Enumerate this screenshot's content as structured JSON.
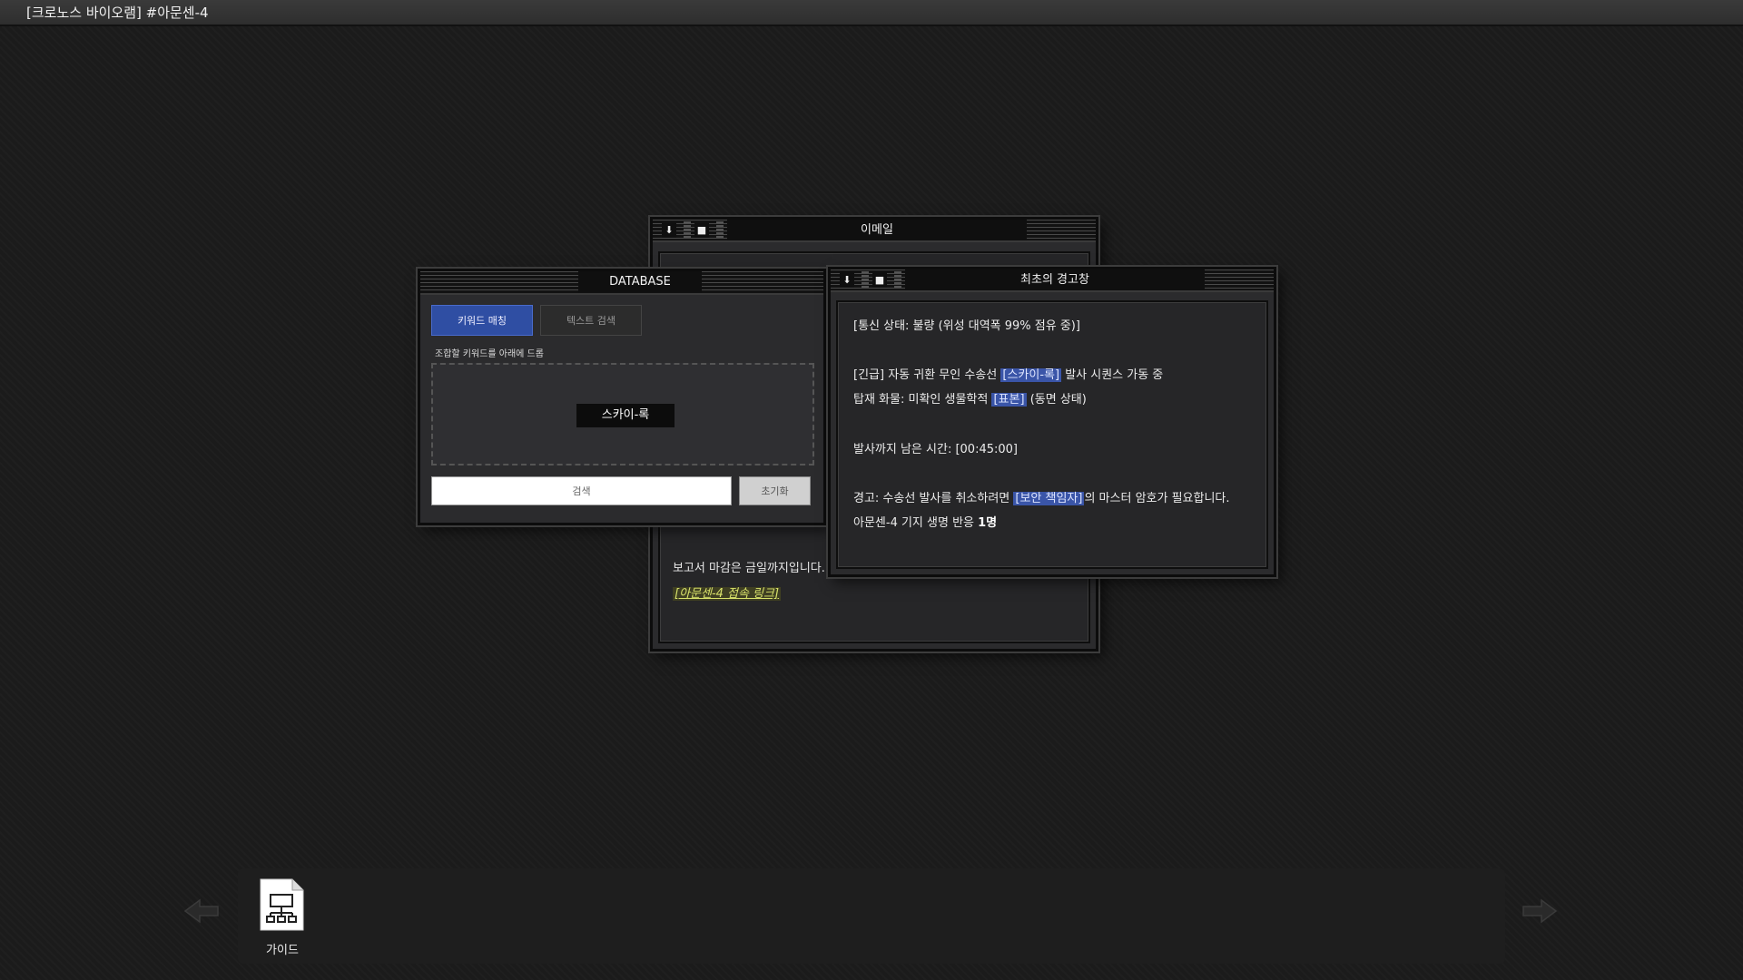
{
  "app": {
    "title": "[크로노스 바이오램] #아문센-4"
  },
  "email_window": {
    "title": "이메일",
    "line_deadline": "보고서 마감은 금일까지입니다. 2",
    "link_text": "[아문센-4 접속 링크]"
  },
  "database_window": {
    "title": "DATABASE",
    "tab_keyword": "키워드 매칭",
    "tab_text": "텍스트 검색",
    "hint": "조합할 키워드를 아래에 드롭",
    "chip": "스카이-록",
    "search_label": "검색",
    "reset_label": "초기화"
  },
  "warning_window": {
    "title": "최초의 경고창",
    "line1": "[통신 상태: 불량 (위성 대역폭 99% 점유 중)]",
    "line2_pre": "[긴급] 자동 귀환 무인 수송선 ",
    "line2_hl": "[스카이-록]",
    "line2_post": " 발사 시퀀스 가동 중",
    "line3_pre": "탑재 화물: 미확인 생물학적 ",
    "line3_hl": "[표본]",
    "line3_post": " (동면 상태)",
    "line4": "발사까지 남은 시간: [00:45:00]",
    "line5_pre": "경고: 수송선 발사를 취소하려면 ",
    "line5_hl": "[보안 책임자]",
    "line5_post": "의 마스터 암호가 필요합니다.",
    "line6_pre": "아문센-4 기지 생명 반응 ",
    "line6_bold": "1명"
  },
  "dock": {
    "guide_label": "가이드"
  },
  "colors": {
    "accent_blue": "#2f4ea3",
    "highlight_blue": "#3a55a8",
    "link_yellow": "#d9e36b"
  }
}
